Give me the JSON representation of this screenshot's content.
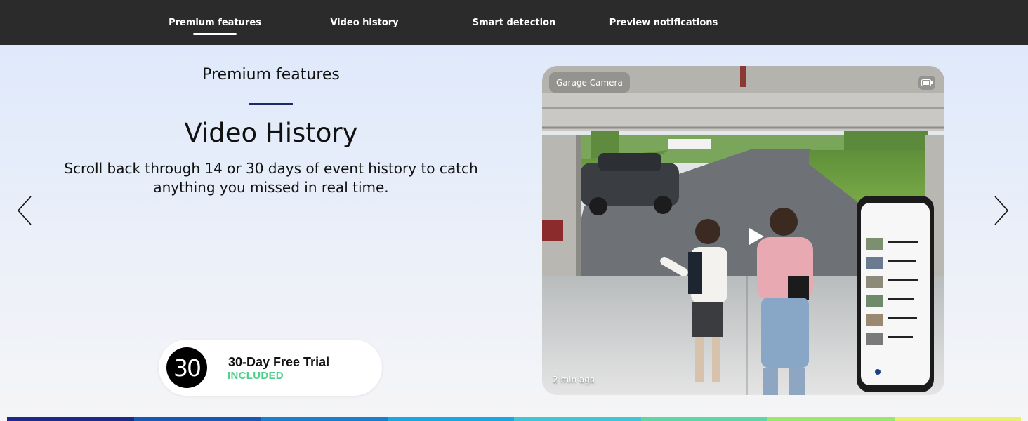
{
  "nav": {
    "tabs": [
      {
        "label": "Premium features",
        "active": true
      },
      {
        "label": "Video history",
        "active": false
      },
      {
        "label": "Smart detection",
        "active": false
      },
      {
        "label": "Preview notifications",
        "active": false
      }
    ]
  },
  "hero": {
    "eyebrow": "Premium features",
    "title": "Video History",
    "description": "Scroll back through 14 or 30 days of event history to catch anything you missed in real time."
  },
  "carousel": {
    "prev_icon": "chevron-left-icon",
    "next_icon": "chevron-right-icon"
  },
  "trial": {
    "badge_number": "30",
    "title": "30-Day Free Trial",
    "status": "INCLUDED",
    "status_color": "#4cd18b"
  },
  "video": {
    "camera_label": "Garage Camera",
    "timestamp": "2 min ago",
    "battery_icon": "battery-icon",
    "play_icon": "play-icon"
  },
  "colors": {
    "nav_bg": "#2b2b2b",
    "accent_rule": "#1d2b6b",
    "brand_bar": [
      "#1a2a8c",
      "#1757b5",
      "#167fd1",
      "#1aa7e6",
      "#3fc6d4",
      "#5dd7a6",
      "#9ce66b",
      "#e9f06b"
    ]
  }
}
